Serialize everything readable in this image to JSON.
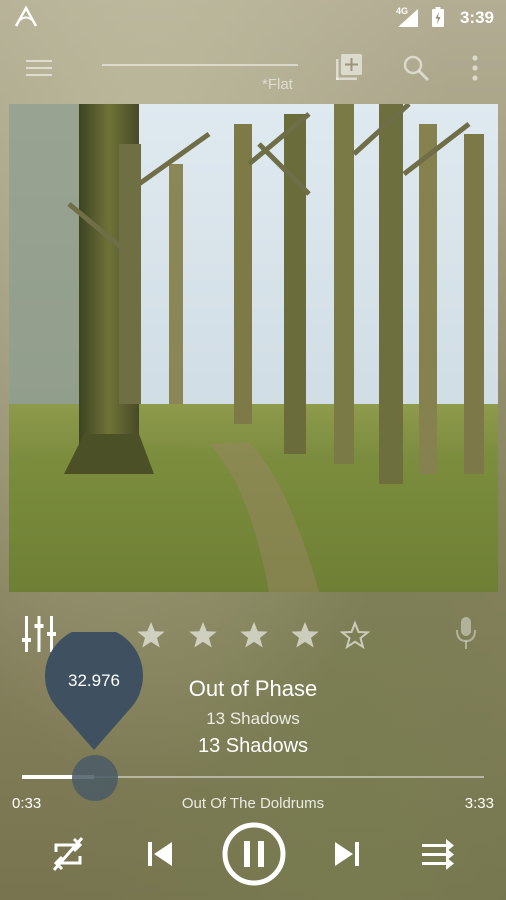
{
  "status": {
    "network": "4G",
    "time": "3:39"
  },
  "toolbar": {
    "preset": "*Flat"
  },
  "icons": {
    "app_logo": "app-logo-icon",
    "menu": "menu-icon",
    "add_queue": "add-queue-icon",
    "search": "search-icon",
    "more": "more-vert-icon",
    "equalizer": "equalizer-icon",
    "mic": "mic-icon",
    "repeat": "repeat-icon",
    "previous": "skip-previous-icon",
    "pause": "pause-icon",
    "next": "skip-next-icon",
    "shuffle": "shuffle-icon"
  },
  "rating": {
    "value": 4,
    "max": 5
  },
  "track": {
    "title": "Out of Phase",
    "artist": "13 Shadows",
    "album": "13 Shadows",
    "next_up": "Out Of The Doldrums"
  },
  "seek": {
    "bubble_value": "32.976",
    "elapsed": "0:33",
    "total": "3:33",
    "progress": 0.155
  },
  "colors": {
    "accent_thumb": "#4a5a66",
    "text": "#ffffff"
  }
}
